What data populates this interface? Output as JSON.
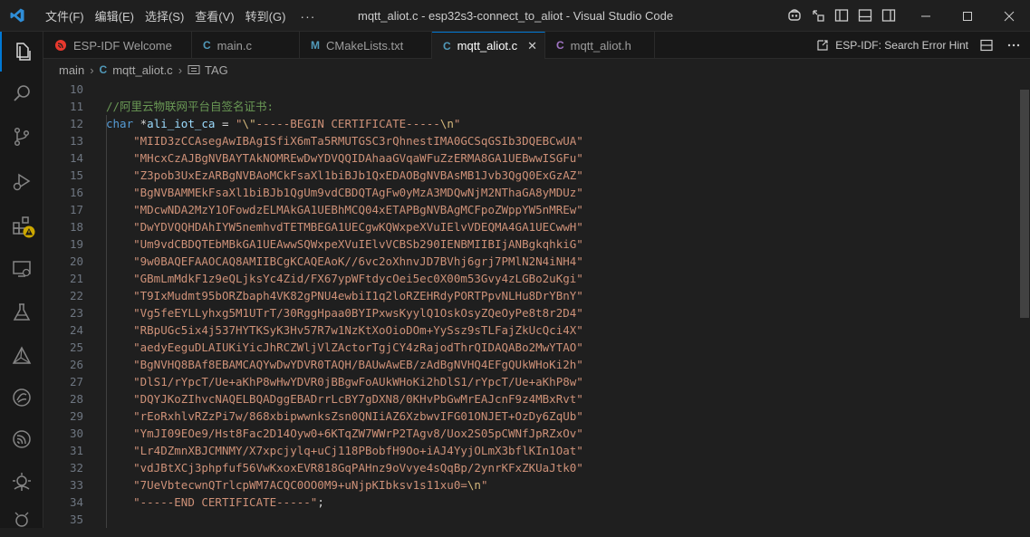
{
  "window": {
    "title": "mqtt_aliot.c - esp32s3-connect_to_aliot - Visual Studio Code",
    "menu": [
      "文件(F)",
      "编辑(E)",
      "选择(S)",
      "查看(V)",
      "转到(G)"
    ],
    "menu_more": "···"
  },
  "tabs": [
    {
      "label": "ESP-IDF Welcome",
      "icon": "espressif-icon",
      "icon_color": "#e8382d"
    },
    {
      "label": "main.c",
      "icon": "C",
      "icon_color": "#519aba"
    },
    {
      "label": "CMakeLists.txt",
      "icon": "M",
      "icon_color": "#519aba"
    },
    {
      "label": "mqtt_aliot.c",
      "icon": "C",
      "icon_color": "#519aba",
      "close": "✕"
    },
    {
      "label": "mqtt_aliot.h",
      "icon": "C",
      "icon_color": "#a074c4"
    }
  ],
  "tab_actions": {
    "hint": "ESP-IDF: Search Error Hint"
  },
  "breadcrumb": {
    "folder": "main",
    "file_icon": "C",
    "file": "mqtt_aliot.c",
    "symbol": "TAG"
  },
  "editor": {
    "line_numbers": [
      "10",
      "11",
      "12",
      "13",
      "14",
      "15",
      "16",
      "17",
      "18",
      "19",
      "20",
      "21",
      "22",
      "23",
      "24",
      "25",
      "26",
      "27",
      "28",
      "29",
      "30",
      "31",
      "32",
      "33",
      "34",
      "35"
    ],
    "comment": "//阿里云物联网平台自签名证书:",
    "decl": {
      "type": "char",
      "ptr": " *",
      "name": "ali_iot_ca",
      "op": " = ",
      "q1": "\"",
      "esc1": "\\\"",
      "str": "-----BEGIN CERTIFICATE-----",
      "esc2": "\\n",
      "q2": "\""
    },
    "cert_lines": [
      "\"MIID3zCCAsegAwIBAgISfiX6mTa5RMUTGSC3rQhnestIMA0GCSqGSIb3DQEBCwUA\"",
      "\"MHcxCzAJBgNVBAYTAkNOMREwDwYDVQQIDAhaaGVqaWFuZzERMA8GA1UEBwwISGFu\"",
      "\"Z3pob3UxEzARBgNVBAoMCkFsaXl1biBJb1QxEDAOBgNVBAsMB1Jvb3QgQ0ExGzAZ\"",
      "\"BgNVBAMMEkFsaXl1biBJb1QgUm9vdCBDQTAgFw0yMzA3MDQwNjM2NThaGA8yMDUz\"",
      "\"MDcwNDA2MzY1OFowdzELMAkGA1UEBhMCQ04xETAPBgNVBAgMCFpoZWppYW5nMREw\"",
      "\"DwYDVQQHDAhIYW5nemhvdTETMBEGA1UECgwKQWxpeXVuIElvVDEQMA4GA1UECwwH\"",
      "\"Um9vdCBDQTEbMBkGA1UEAwwSQWxpeXVuIElvVCBSb290IENBMIIBIjANBgkqhkiG\"",
      "\"9w0BAQEFAAOCAQ8AMIIBCgKCAQEAoK//6vc2oXhnvJD7BVhj6grj7PMlN2N4iNH4\"",
      "\"GBmLmMdkF1z9eQLjksYc4Zid/FX67ypWFtdycOei5ec0X00m53Gvy4zLGBo2uKgi\"",
      "\"T9IxMudmt95bORZbaph4VK82gPNU4ewbiI1q2loRZEHRdyPORTPpvNLHu8DrYBnY\"",
      "\"Vg5feEYLLyhxg5M1UTrT/30RggHpaa0BYIPxwsKyylQ1OskOsyZQeOyPe8t8r2D4\"",
      "\"RBpUGc5ix4j537HYTKSyK3Hv57R7w1NzKtXoOioDOm+YySsz9sTLFajZkUcQci4X\"",
      "\"aedyEeguDLAIUKiYicJhRCZWljVlZActorTgjCY4zRajodThrQIDAQABo2MwYTAO\"",
      "\"BgNVHQ8BAf8EBAMCAQYwDwYDVR0TAQH/BAUwAwEB/zAdBgNVHQ4EFgQUkWHoKi2h\"",
      "\"DlS1/rYpcT/Ue+aKhP8wHwYDVR0jBBgwFoAUkWHoKi2hDlS1/rYpcT/Ue+aKhP8w\"",
      "\"DQYJKoZIhvcNAQELBQADggEBADrrLcBY7gDXN8/0KHvPbGwMrEAJcnF9z4MBxRvt\"",
      "\"rEoRxhlvRZzPi7w/868xbipwwnksZsn0QNIiAZ6XzbwvIFG01ONJET+OzDy6ZqUb\"",
      "\"YmJI09EOe9/Hst8Fac2D14Oyw0+6KTqZW7WWrP2TAgv8/Uox2S05pCWNfJpRZxOv\"",
      "\"Lr4DZmnXBJCMNMY/X7xpcjylq+uCj118PBobfH9Oo+iAJ4YyjOLmX3bflKIn1Oat\"",
      "\"vdJBtXCj3phpfuf56VwKxoxEVR818GqPAHnz9oVvye4sQqBp/2ynrKFxZKUaJtk0\""
    ],
    "cert_last": {
      "str": "\"7UeVbtecwnQTrlcpWM7ACQC0OO0M9+uNjpKIbksv1s11xu0=",
      "esc": "\\n",
      "q": "\""
    },
    "end_line": {
      "str": "\"-----END CERTIFICATE-----\"",
      "semi": ";"
    }
  },
  "colors": {
    "accent": "#0078d4",
    "background": "#1f1f1f",
    "warning": "#cca700"
  }
}
